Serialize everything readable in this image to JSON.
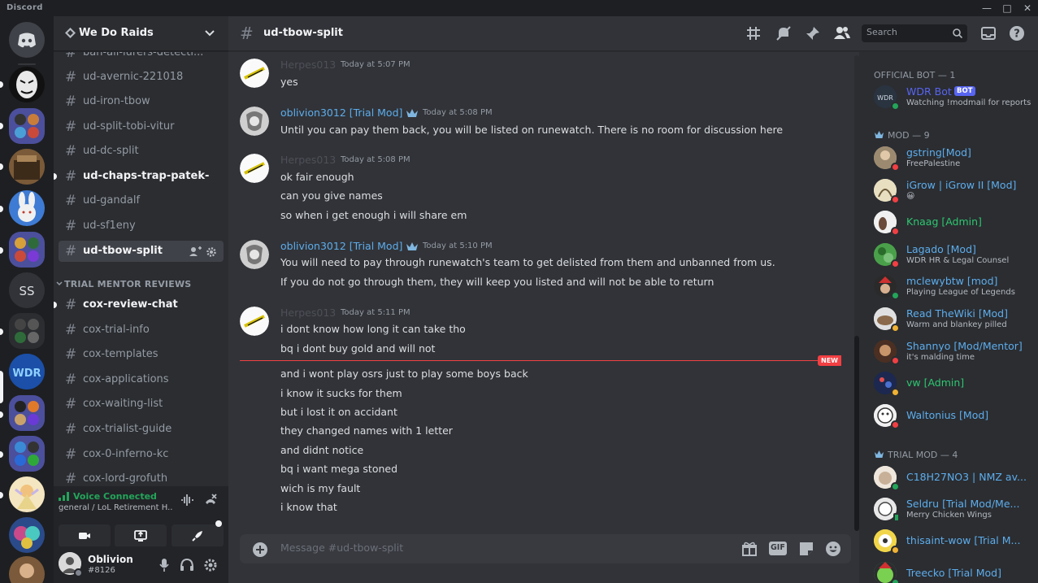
{
  "app": {
    "wordmark": "Discord"
  },
  "guild": {
    "name": "We Do Raids"
  },
  "channels": [
    {
      "name": "ban-all-lurers-detecti...",
      "state": "normal"
    },
    {
      "name": "ud-avernic-221018",
      "state": "normal"
    },
    {
      "name": "ud-iron-tbow",
      "state": "normal"
    },
    {
      "name": "ud-split-tobi-vitur",
      "state": "normal"
    },
    {
      "name": "ud-dc-split",
      "state": "normal"
    },
    {
      "name": "ud-chaps-trap-patek-",
      "state": "unread"
    },
    {
      "name": "ud-gandalf",
      "state": "normal"
    },
    {
      "name": "ud-sf1eny",
      "state": "normal"
    },
    {
      "name": "ud-tbow-split",
      "state": "selected"
    }
  ],
  "category": {
    "label": "TRIAL MENTOR REVIEWS"
  },
  "channels2": [
    {
      "name": "cox-review-chat",
      "state": "unread"
    },
    {
      "name": "cox-trial-info",
      "state": "normal"
    },
    {
      "name": "cox-templates",
      "state": "normal"
    },
    {
      "name": "cox-applications",
      "state": "normal"
    },
    {
      "name": "cox-waiting-list",
      "state": "normal"
    },
    {
      "name": "cox-trialist-guide",
      "state": "normal"
    },
    {
      "name": "cox-0-inferno-kc",
      "state": "normal"
    },
    {
      "name": "cox-lord-grofuth",
      "state": "normal"
    }
  ],
  "voice": {
    "status": "Voice Connected",
    "channel": "general / LoL Retirement H..."
  },
  "user": {
    "name": "Oblivion",
    "tag": "#8126"
  },
  "rail": {
    "ss_label": "SS"
  },
  "header": {
    "channel": "ud-tbow-split",
    "search_placeholder": "Search"
  },
  "messages": [
    {
      "author": "Herpes013",
      "time": "Today at 5:07 PM",
      "lines": [
        "yes"
      ]
    },
    {
      "author": "oblivion3012 [Trial Mod]",
      "time": "Today at 5:08 PM",
      "lines": [
        "Until you can pay them back, you will be listed on runewatch. There is no room for discussion here"
      ]
    },
    {
      "author": "Herpes013",
      "time": "Today at 5:08 PM",
      "lines": [
        "ok fair enough",
        "can you give names",
        "so when i get enough i will share em"
      ]
    },
    {
      "author": "oblivion3012 [Trial Mod]",
      "time": "Today at 5:10 PM",
      "lines": [
        "You will need to pay through runewatch's team to get delisted from them and unbanned from us.",
        "If you do not go through them, they will keep you listed and will not be able to return"
      ]
    },
    {
      "author": "Herpes013",
      "time": "Today at 5:11 PM",
      "lines": [
        "i dont know how long it can take tho",
        "bq i dont buy gold and will not",
        "and i wont play osrs just to play some boys back",
        "i know it sucks for them",
        "but i lost it on accidant",
        "they changed names with 1 letter",
        "and didnt notice",
        "bq i want mega stoned",
        "wich is my fault",
        "i know that"
      ]
    }
  ],
  "new_label": "NEW",
  "composer": {
    "placeholder": "Message #ud-tbow-split",
    "gif_label": "GIF"
  },
  "members": {
    "cat_bot": "OFFICIAL BOT — 1",
    "cat_mod": "MOD — 9",
    "cat_trial": "TRIAL MOD — 4",
    "bot_badge": "BOT",
    "list": [
      {
        "name": "WDR Bot",
        "sub": "Watching !modmail for reports",
        "color": "#5865f2",
        "status": "online"
      },
      {
        "name": "gstring[Mod]",
        "sub": "FreePalestine",
        "color": "#5dadec",
        "status": "dnd"
      },
      {
        "name": "iGrow | iGrow II [Mod]",
        "sub": "😀",
        "color": "#5dadec",
        "status": "dnd"
      },
      {
        "name": "Knaag [Admin]",
        "sub": "",
        "color": "#2dc770",
        "status": "dnd"
      },
      {
        "name": "Lagado [Mod]",
        "sub": "WDR HR & Legal Counsel",
        "color": "#5dadec",
        "status": "dnd"
      },
      {
        "name": "mclewybtw [mod]",
        "sub": "Playing League of Legends",
        "color": "#5dadec",
        "status": "online"
      },
      {
        "name": "Read TheWiki [Mod]",
        "sub": "Warm and blankey pilled",
        "color": "#5dadec",
        "status": "idle"
      },
      {
        "name": "Shannyo [Mod/Mentor]",
        "sub": "it's malding time",
        "color": "#5dadec",
        "status": "dnd"
      },
      {
        "name": "vw [Admin]",
        "sub": "",
        "color": "#2dc770",
        "status": "idle"
      },
      {
        "name": "Waltonius [Mod]",
        "sub": "",
        "color": "#5dadec",
        "status": "dnd"
      },
      {
        "name": "C18H27NO3 | NMZ av...",
        "sub": "",
        "color": "#5dadec",
        "status": "online"
      },
      {
        "name": "Seldru [Trial Mod/Me...",
        "sub": "Merry Chicken Wings",
        "color": "#5dadec",
        "status": "mobile"
      },
      {
        "name": "thisaint-wow [Trial M...",
        "sub": "",
        "color": "#5dadec",
        "status": "idle"
      },
      {
        "name": "Treecko [Trial Mod]",
        "sub": "",
        "color": "#5dadec",
        "status": "online"
      }
    ]
  },
  "colors": {
    "accent": "#5865f2",
    "mod_blue": "#5dadec",
    "admin_green": "#2dc770",
    "new_red": "#f23f43",
    "voice_green": "#23a55a"
  }
}
